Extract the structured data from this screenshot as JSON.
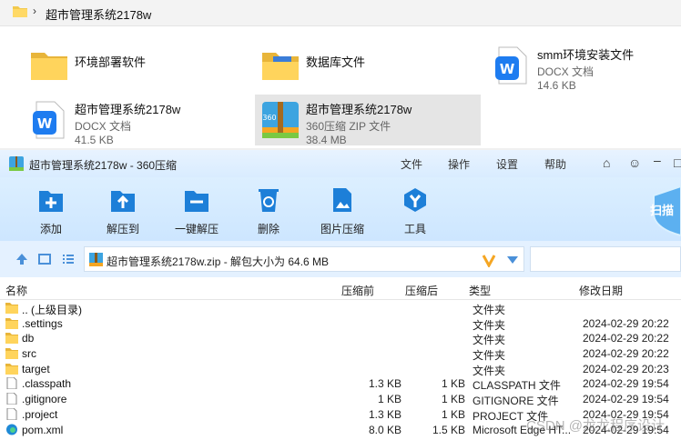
{
  "explorer": {
    "breadcrumb": "超市管理系统2178w",
    "files": [
      {
        "name": "环境部署软件",
        "kind": "folder"
      },
      {
        "name": "数据库文件",
        "kind": "folder-doc"
      },
      {
        "name": "smm环境安装文件",
        "type": "DOCX 文档",
        "size": "14.6 KB",
        "kind": "docx"
      },
      {
        "name": "超市管理系统2178w",
        "type": "DOCX 文档",
        "size": "41.5 KB",
        "kind": "docx"
      },
      {
        "name": "超市管理系统2178w",
        "type": "360压缩 ZIP 文件",
        "size": "38.4 MB",
        "kind": "zip"
      }
    ]
  },
  "z360": {
    "title": "超市管理系统2178w - 360压缩",
    "menu": [
      "文件",
      "操作",
      "设置",
      "帮助"
    ],
    "toolbar": [
      "添加",
      "解压到",
      "一键解压",
      "删除",
      "图片压缩",
      "工具"
    ],
    "scan_label": "扫描",
    "address": "超市管理系统2178w.zip - 解包大小为 64.6 MB",
    "columns": {
      "name": "名称",
      "size": "压缩前",
      "csize": "压缩后",
      "type": "类型",
      "date": "修改日期"
    },
    "rows": [
      {
        "name": ".. (上级目录)",
        "size": "",
        "csize": "",
        "type": "文件夹",
        "date": "",
        "icon": "folder"
      },
      {
        "name": ".settings",
        "size": "",
        "csize": "",
        "type": "文件夹",
        "date": "2024-02-29 20:22",
        "icon": "folder"
      },
      {
        "name": "db",
        "size": "",
        "csize": "",
        "type": "文件夹",
        "date": "2024-02-29 20:22",
        "icon": "folder"
      },
      {
        "name": "src",
        "size": "",
        "csize": "",
        "type": "文件夹",
        "date": "2024-02-29 20:22",
        "icon": "folder"
      },
      {
        "name": "target",
        "size": "",
        "csize": "",
        "type": "文件夹",
        "date": "2024-02-29 20:23",
        "icon": "folder"
      },
      {
        "name": ".classpath",
        "size": "1.3 KB",
        "csize": "1 KB",
        "type": "CLASSPATH 文件",
        "date": "2024-02-29 19:54",
        "icon": "file"
      },
      {
        "name": ".gitignore",
        "size": "1 KB",
        "csize": "1 KB",
        "type": "GITIGNORE 文件",
        "date": "2024-02-29 19:54",
        "icon": "file"
      },
      {
        "name": ".project",
        "size": "1.3 KB",
        "csize": "1 KB",
        "type": "PROJECT 文件",
        "date": "2024-02-29 19:54",
        "icon": "file"
      },
      {
        "name": "pom.xml",
        "size": "8.0 KB",
        "csize": "1.5 KB",
        "type": "Microsoft Edge HT...",
        "date": "2024-02-29 19:54",
        "icon": "edge"
      }
    ]
  },
  "watermark": "CSDN @龙龙程序设计"
}
